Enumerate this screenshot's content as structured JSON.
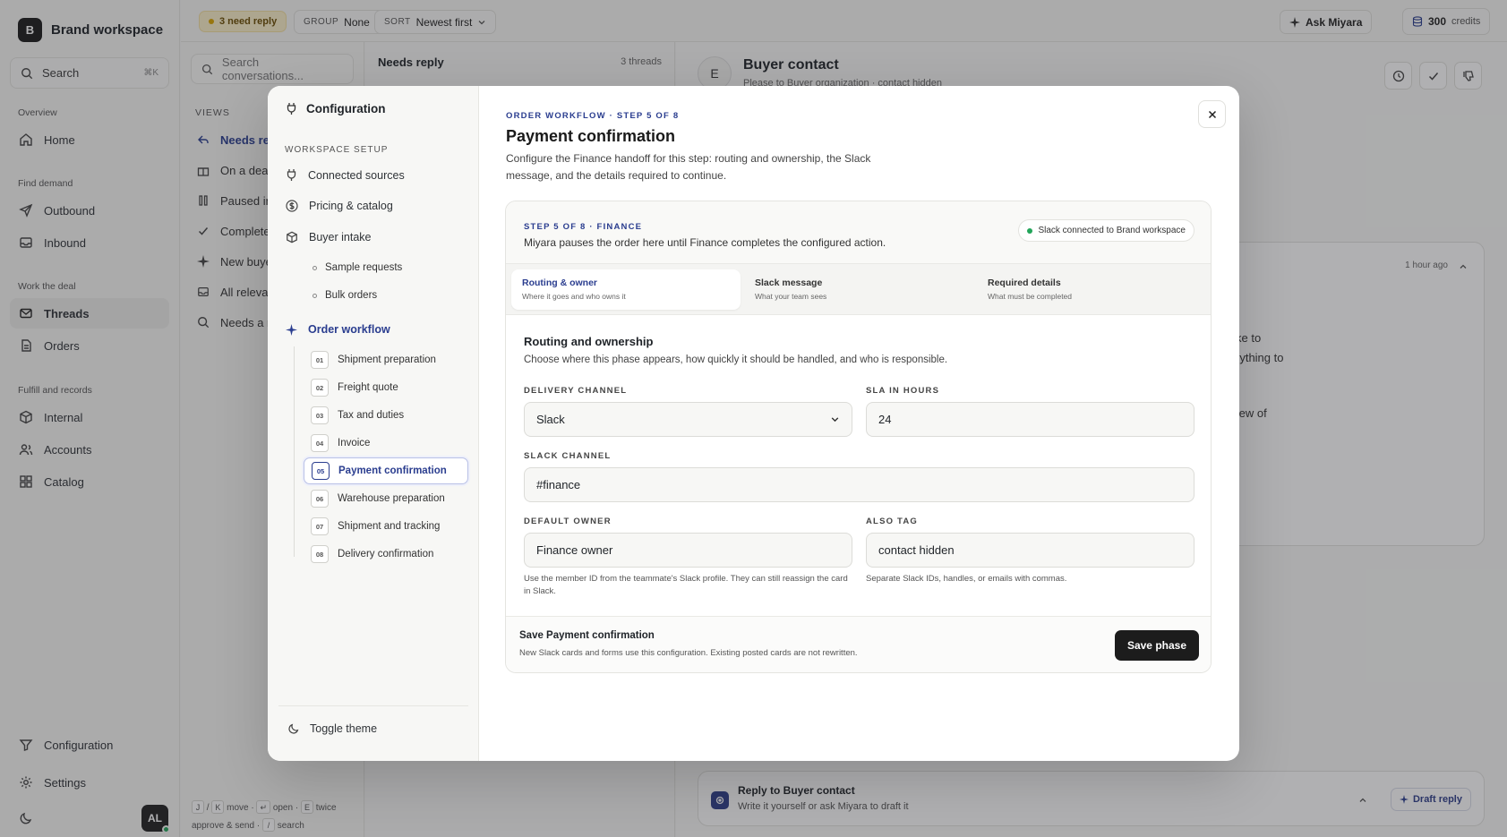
{
  "sidebar": {
    "brand_initial": "B",
    "brand_name": "Brand workspace",
    "search_label": "Search",
    "search_shortcut": "⌘K",
    "sections": {
      "overview": "Overview",
      "find_demand": "Find demand",
      "work_the_deal": "Work the deal",
      "fulfill": "Fulfill and records"
    },
    "items": {
      "home": "Home",
      "outbound": "Outbound",
      "inbound": "Inbound",
      "threads": "Threads",
      "orders": "Orders",
      "internal": "Internal",
      "accounts": "Accounts",
      "catalog": "Catalog",
      "configuration": "Configuration",
      "settings": "Settings"
    },
    "avatar_initials": "AL"
  },
  "topbar": {
    "needs_reply": "3 need reply",
    "group_label": "GROUP",
    "group_value": "None",
    "sort_label": "SORT",
    "sort_value": "Newest first",
    "ask_label": "Ask Miyara",
    "credits": "300",
    "credits_label": "credits"
  },
  "conversations": {
    "search_placeholder": "Search conversations...",
    "views_label": "VIEWS",
    "views": [
      "Needs reply",
      "On a deal",
      "Paused in",
      "Completed",
      "New buyers",
      "All relevant",
      "Needs a r"
    ],
    "footer": {
      "k1": "J",
      "sep": "/",
      "k2": "K",
      "move": "move ·",
      "k3": "↵",
      "open": "open ·",
      "k4": "E",
      "twice": "twice",
      "approve": "approve & send ·",
      "k5": "/",
      "search": "search"
    }
  },
  "thread_list": {
    "title": "Needs reply",
    "count": "3 threads"
  },
  "main": {
    "contact_initial": "E",
    "contact_name": "Buyer contact",
    "contact_sub": "Please to Buyer organization · contact hidden",
    "message_time": "1 hour ago",
    "msg_lines": [
      "ke to",
      "rything to",
      "few of"
    ],
    "reply_title": "Reply to Buyer contact",
    "reply_sub": "Write it yourself or ask Miyara to draft it",
    "draft_label": "Draft reply"
  },
  "modal": {
    "side_title": "Configuration",
    "section_label": "WORKSPACE SETUP",
    "connected_sources": "Connected sources",
    "pricing_catalog": "Pricing & catalog",
    "buyer_intake": "Buyer intake",
    "sample_requests": "Sample requests",
    "bulk_orders": "Bulk orders",
    "order_workflow": "Order workflow",
    "steps": [
      {
        "num": "01",
        "label": "Shipment preparation"
      },
      {
        "num": "02",
        "label": "Freight quote"
      },
      {
        "num": "03",
        "label": "Tax and duties"
      },
      {
        "num": "04",
        "label": "Invoice"
      },
      {
        "num": "05",
        "label": "Payment confirmation"
      },
      {
        "num": "06",
        "label": "Warehouse preparation"
      },
      {
        "num": "07",
        "label": "Shipment and tracking"
      },
      {
        "num": "08",
        "label": "Delivery confirmation"
      }
    ],
    "toggle_theme": "Toggle theme",
    "crumb": "ORDER WORKFLOW · STEP 5 OF 8",
    "title": "Payment confirmation",
    "description": "Configure the Finance handoff for this step: routing and ownership, the Slack message, and the details required to continue.",
    "card": {
      "step_label": "STEP 5 OF 8 · FINANCE",
      "step_desc": "Miyara pauses the order here until Finance completes the configured action.",
      "slack_status": "Slack connected to Brand workspace",
      "tabs": [
        {
          "label": "Routing & owner",
          "sub": "Where it goes and who owns it"
        },
        {
          "label": "Slack message",
          "sub": "What your team sees"
        },
        {
          "label": "Required details",
          "sub": "What must be completed"
        }
      ],
      "section_title": "Routing and ownership",
      "section_desc": "Choose where this phase appears, how quickly it should be handled, and who is responsible.",
      "delivery_channel_label": "DELIVERY CHANNEL",
      "delivery_channel_value": "Slack",
      "sla_label": "SLA IN HOURS",
      "sla_value": "24",
      "slack_channel_label": "SLACK CHANNEL",
      "slack_channel_value": "#finance",
      "default_owner_label": "DEFAULT OWNER",
      "default_owner_value": "Finance owner",
      "also_tag_label": "ALSO TAG",
      "also_tag_value": "contact hidden",
      "owner_help": "Use the member ID from the teammate's Slack profile. They can still reassign the card in Slack.",
      "tag_help": "Separate Slack IDs, handles, or emails with commas.",
      "footer_title": "Save Payment confirmation",
      "footer_desc": "New Slack cards and forms use this configuration. Existing posted cards are not rewritten.",
      "save_label": "Save phase"
    }
  },
  "colors": {
    "accent": "#2a3d8f",
    "status_green": "#22a559",
    "warning": "#d9a400",
    "primary_button": "#1c1c1c"
  }
}
